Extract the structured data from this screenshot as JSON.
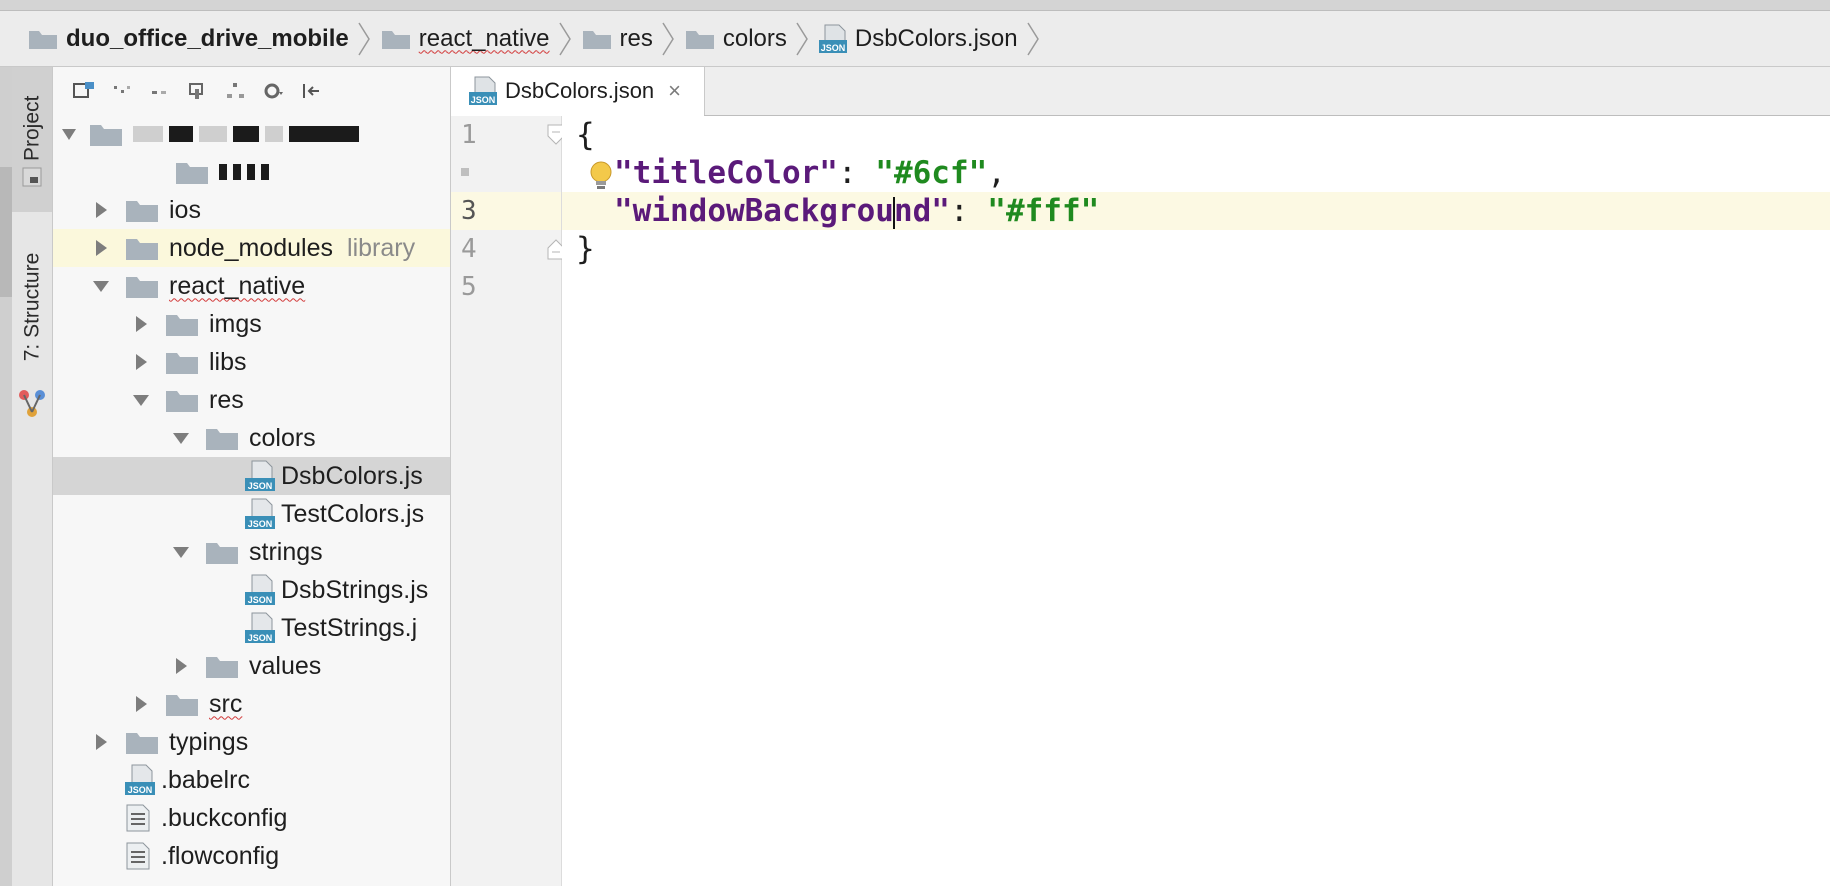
{
  "breadcrumbs": {
    "items": [
      {
        "label": "duo_office_drive_mobile",
        "type": "folder",
        "bold": true
      },
      {
        "label": "react_native",
        "type": "folder",
        "squiggle": true
      },
      {
        "label": "res",
        "type": "folder"
      },
      {
        "label": "colors",
        "type": "folder"
      },
      {
        "label": "DsbColors.json",
        "type": "json"
      }
    ]
  },
  "side_tabs": {
    "project": "1: Project",
    "structure": "7: Structure"
  },
  "project_tree": {
    "rows": [
      {
        "label": "ios",
        "kind": "folder",
        "depth": 1,
        "expanded": false
      },
      {
        "label": "node_modules",
        "suffix": "library",
        "kind": "folder",
        "depth": 1,
        "expanded": false
      },
      {
        "label": "react_native",
        "kind": "folder",
        "depth": 1,
        "expanded": true,
        "squiggle": true
      },
      {
        "label": "imgs",
        "kind": "folder",
        "depth": 2,
        "expanded": false
      },
      {
        "label": "libs",
        "kind": "folder",
        "depth": 2,
        "expanded": false
      },
      {
        "label": "res",
        "kind": "folder",
        "depth": 2,
        "expanded": true
      },
      {
        "label": "colors",
        "kind": "folder",
        "depth": 3,
        "expanded": true
      },
      {
        "label": "DsbColors.js",
        "kind": "json",
        "depth": 4,
        "selected": true
      },
      {
        "label": "TestColors.js",
        "kind": "json",
        "depth": 4
      },
      {
        "label": "strings",
        "kind": "folder",
        "depth": 3,
        "expanded": true
      },
      {
        "label": "DsbStrings.js",
        "kind": "json",
        "depth": 4
      },
      {
        "label": "TestStrings.j",
        "kind": "json",
        "depth": 4
      },
      {
        "label": "values",
        "kind": "folder",
        "depth": 3,
        "expanded": false
      },
      {
        "label": "src",
        "kind": "folder",
        "depth": 2,
        "expanded": false,
        "squiggle": true
      },
      {
        "label": "typings",
        "kind": "folder",
        "depth": 1,
        "expanded": false
      },
      {
        "label": ".babelrc",
        "kind": "json",
        "depth": 1
      },
      {
        "label": ".buckconfig",
        "kind": "file",
        "depth": 1
      },
      {
        "label": ".flowconfig",
        "kind": "file",
        "depth": 1
      }
    ]
  },
  "editor": {
    "tab_label": "DsbColors.json",
    "tab_close": "×",
    "line_numbers": [
      "1",
      "",
      "3",
      "4",
      "5"
    ],
    "lines": {
      "l1": "{",
      "l2_key": "\"titleColor\"",
      "l2_sep": ": ",
      "l2_val": "\"#6cf\"",
      "l2_end": ",",
      "l3_key_a": "\"windowBackgrou",
      "l3_key_b": "nd\"",
      "l3_sep": ": ",
      "l3_val": "\"#fff\"",
      "l4": "}"
    }
  },
  "colors": {
    "folder": "#a9b3bc",
    "json_badge": "#3a8fb7",
    "key": "#5b1a7a",
    "string": "#1f8a1f",
    "current_line": "#fcf9e3"
  }
}
